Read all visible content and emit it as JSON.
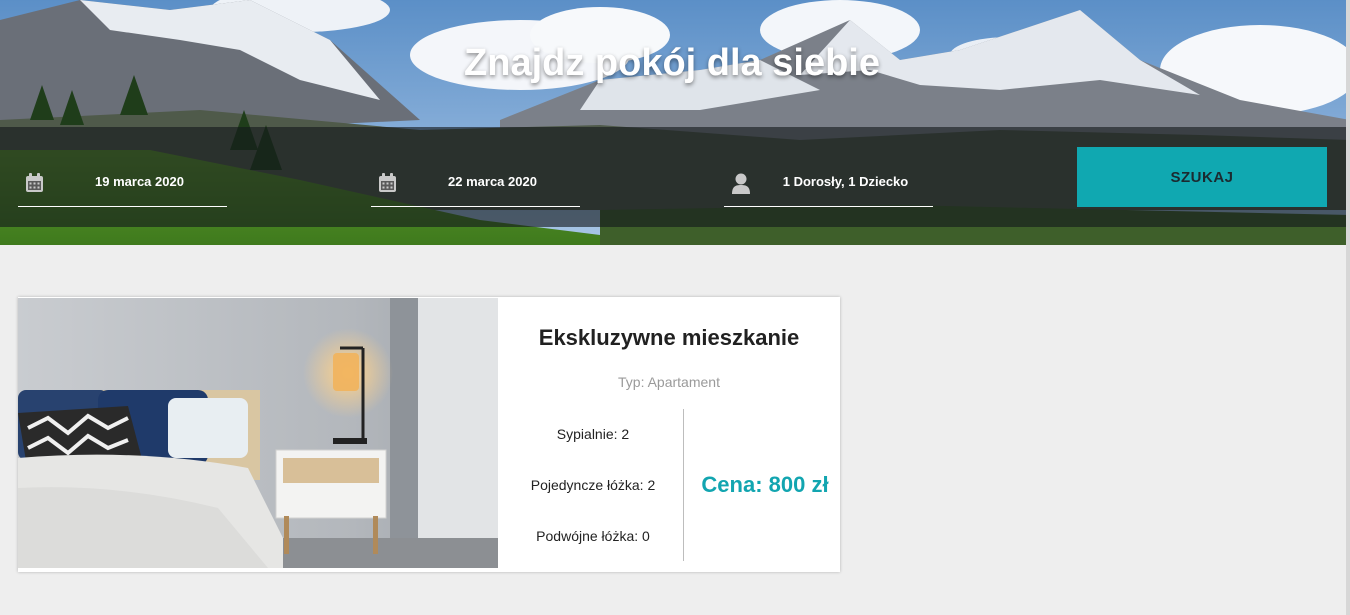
{
  "hero": {
    "title": "Znajdz pokój dla siebie"
  },
  "search": {
    "check_in": {
      "value": "19 marca 2020",
      "icon": "calendar-icon"
    },
    "check_out": {
      "value": "22 marca 2020",
      "icon": "calendar-icon"
    },
    "guests": {
      "value": "1 Dorosły, 1 Dziecko",
      "icon": "person-icon"
    },
    "button_label": "SZUKAJ"
  },
  "listing": {
    "title": "Ekskluzywne mieszkanie",
    "type": "Typ: Apartament",
    "bedrooms": "Sypialnie: 2",
    "single_beds": "Pojedyncze łóżka: 2",
    "double_beds": "Podwójne łóżka: 0",
    "price": "Cena: 800 zł"
  },
  "colors": {
    "accent": "#10a8b1",
    "page_background": "#eeeeee",
    "card_background": "#ffffff"
  }
}
